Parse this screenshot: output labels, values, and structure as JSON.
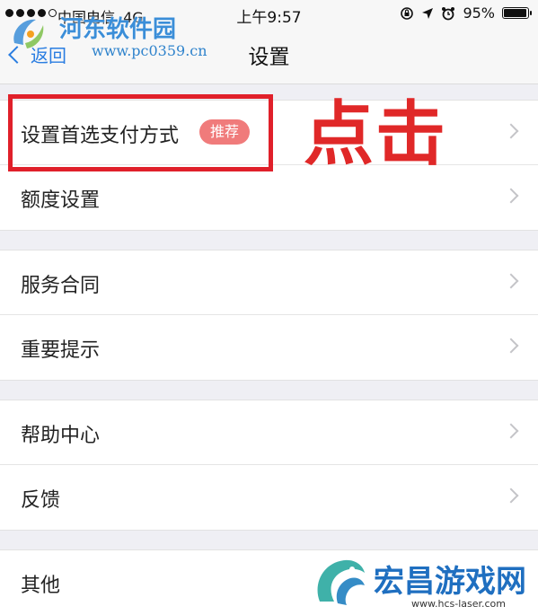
{
  "status_bar": {
    "carrier": "中国电信",
    "network": "4G",
    "time": "上午9:57",
    "battery_percent": "95%",
    "battery_level": 0.95,
    "icons": [
      "lock-rotation-icon",
      "location-arrow-icon",
      "alarm-icon",
      "battery-icon"
    ]
  },
  "nav": {
    "back_label": "返回",
    "title": "设置"
  },
  "sections": [
    {
      "items": [
        {
          "label": "设置首选支付方式",
          "badge": "推荐"
        },
        {
          "label": "额度设置"
        }
      ]
    },
    {
      "items": [
        {
          "label": "服务合同"
        },
        {
          "label": "重要提示"
        }
      ]
    },
    {
      "items": [
        {
          "label": "帮助中心"
        },
        {
          "label": "反馈"
        }
      ]
    },
    {
      "items": [
        {
          "label": "其他"
        }
      ]
    }
  ],
  "annotation": {
    "click_text": "点击",
    "color": "#e0202a"
  },
  "watermarks": {
    "top_name": "河东软件园",
    "top_url": "www.pc0359.cn",
    "bottom_name": "宏昌游戏网",
    "bottom_url": "www.hcs-laser.com"
  },
  "colors": {
    "accent": "#2a7de1",
    "badge": "#f07b7b",
    "background": "#efeff4"
  }
}
